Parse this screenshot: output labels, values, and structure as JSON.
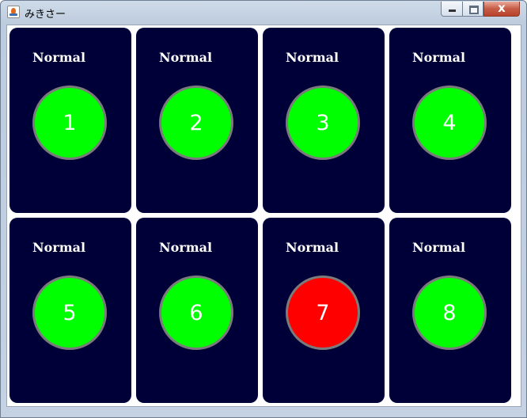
{
  "window": {
    "title": "みきさー",
    "controls": {
      "minimize_icon": "minimize-icon",
      "maximize_icon": "maximize-icon",
      "close_icon": "close-icon",
      "close_glyph": "x"
    }
  },
  "colors": {
    "panel_background": "#000038",
    "status_normal": "#00ff00",
    "status_alarm": "#ff0000",
    "lamp_border": "#7b7b7b",
    "label_text": "#ffffff"
  },
  "panels": [
    {
      "label": "Normal",
      "number": "1",
      "status_color": "#00ff00"
    },
    {
      "label": "Normal",
      "number": "2",
      "status_color": "#00ff00"
    },
    {
      "label": "Normal",
      "number": "3",
      "status_color": "#00ff00"
    },
    {
      "label": "Normal",
      "number": "4",
      "status_color": "#00ff00"
    },
    {
      "label": "Normal",
      "number": "5",
      "status_color": "#00ff00"
    },
    {
      "label": "Normal",
      "number": "6",
      "status_color": "#00ff00"
    },
    {
      "label": "Normal",
      "number": "7",
      "status_color": "#ff0000"
    },
    {
      "label": "Normal",
      "number": "8",
      "status_color": "#00ff00"
    }
  ]
}
